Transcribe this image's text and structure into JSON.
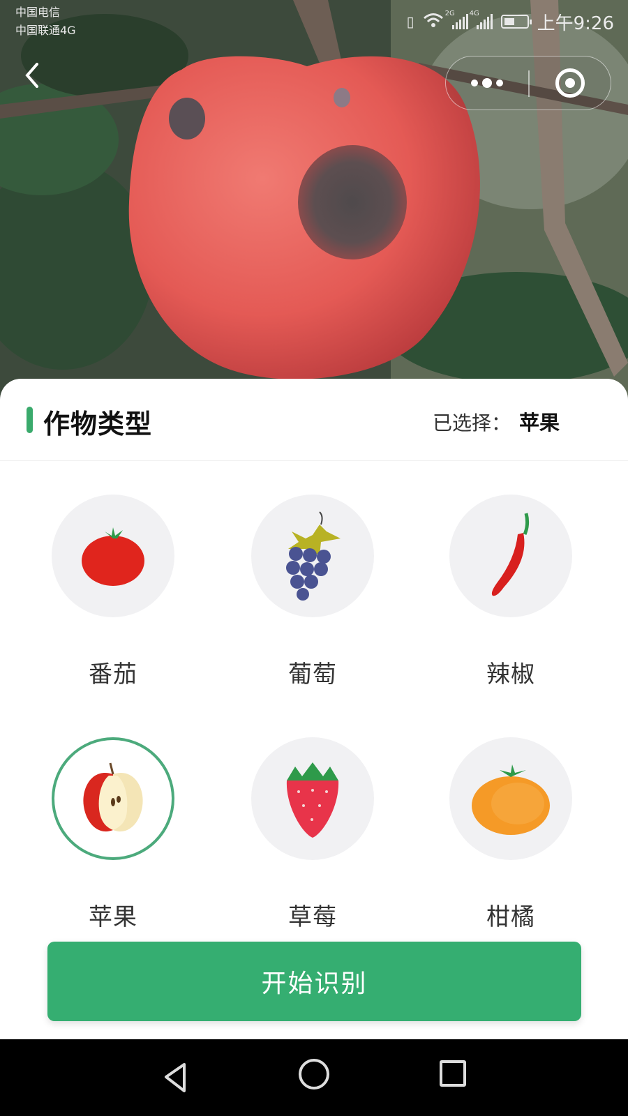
{
  "status_bar": {
    "carrier_1": "中国电信",
    "carrier_2": "中国联通4G",
    "signal_1_tag": "2G",
    "signal_2_tag": "4G",
    "time": "上午9:26"
  },
  "header": {
    "back_icon": "chevron-left-icon",
    "more_icon": "more-dots-icon",
    "close_icon": "target-circle-icon"
  },
  "hero": {
    "icon": "diseased-apple-photo"
  },
  "sheet": {
    "title": "作物类型",
    "selected_label": "已选择：",
    "selected_value": "苹果",
    "accent_color": "#3aaa6c"
  },
  "crops": [
    {
      "label": "番茄",
      "icon": "tomato-icon",
      "selected": false
    },
    {
      "label": "葡萄",
      "icon": "grapes-icon",
      "selected": false
    },
    {
      "label": "辣椒",
      "icon": "chili-pepper-icon",
      "selected": false
    },
    {
      "label": "苹果",
      "icon": "apple-icon",
      "selected": true
    },
    {
      "label": "草莓",
      "icon": "strawberry-icon",
      "selected": false
    },
    {
      "label": "柑橘",
      "icon": "orange-icon",
      "selected": false
    }
  ],
  "start_button": {
    "label": "开始识别",
    "color": "#35ae71"
  },
  "nav_bar": {
    "back_icon": "triangle-back-icon",
    "home_icon": "circle-home-icon",
    "recent_icon": "square-recent-icon"
  }
}
